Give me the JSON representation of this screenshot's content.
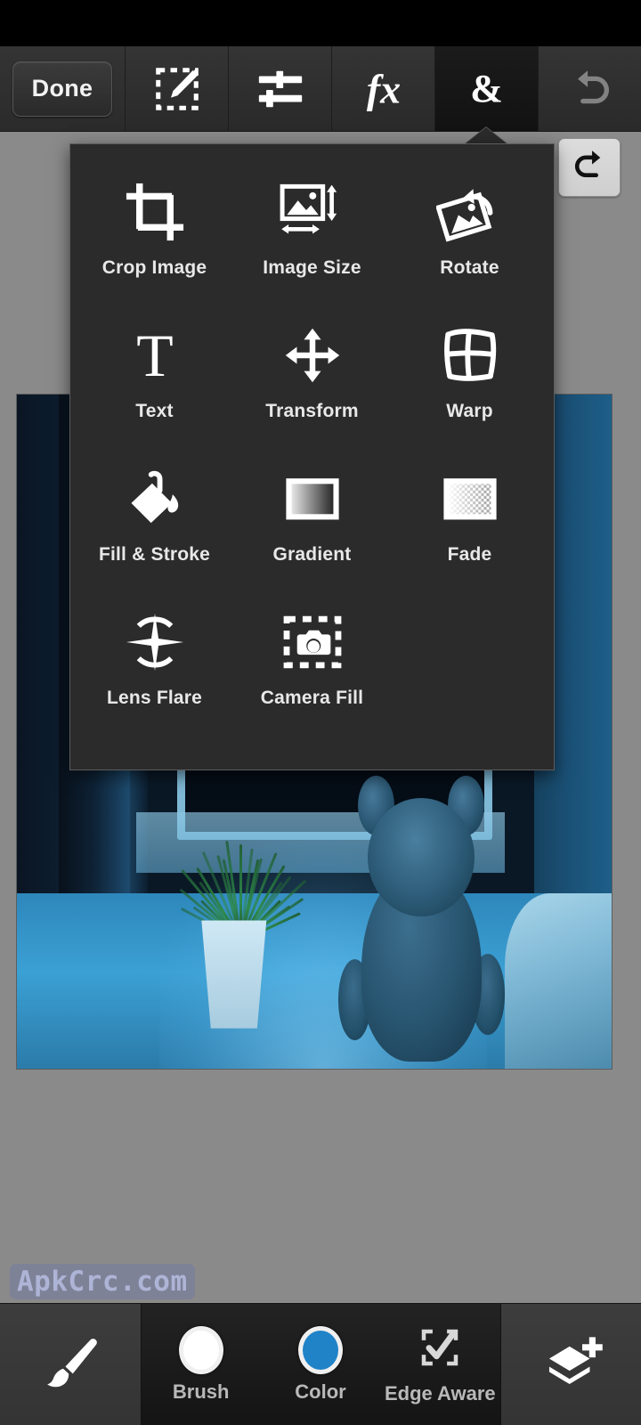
{
  "app": {
    "background_color": "#8a8a8a",
    "accent_color": "#2083c8",
    "panel_color": "#2b2b2b"
  },
  "topbar": {
    "done_label": "Done",
    "tabs": [
      {
        "name": "selection-edit",
        "icon": "selection-pencil-icon",
        "active": false
      },
      {
        "name": "adjustments",
        "icon": "sliders-icon",
        "active": false
      },
      {
        "name": "effects",
        "icon": "fx-icon",
        "active": false
      },
      {
        "name": "add-ons",
        "icon": "ampersand-icon",
        "label": "&",
        "active": true
      },
      {
        "name": "undo",
        "icon": "undo-icon",
        "active": false
      }
    ]
  },
  "redo_button": {
    "label": "",
    "icon": "redo-icon"
  },
  "popup_menu": {
    "items": [
      {
        "label": "Crop Image",
        "icon": "crop-icon"
      },
      {
        "label": "Image Size",
        "icon": "image-size-icon"
      },
      {
        "label": "Rotate",
        "icon": "rotate-icon"
      },
      {
        "label": "Text",
        "icon": "text-icon"
      },
      {
        "label": "Transform",
        "icon": "transform-icon"
      },
      {
        "label": "Warp",
        "icon": "warp-icon"
      },
      {
        "label": "Fill & Stroke",
        "icon": "fill-stroke-icon"
      },
      {
        "label": "Gradient",
        "icon": "gradient-icon"
      },
      {
        "label": "Fade",
        "icon": "fade-icon"
      },
      {
        "label": "Lens Flare",
        "icon": "lens-flare-icon"
      },
      {
        "label": "Camera Fill",
        "icon": "camera-fill-icon"
      }
    ]
  },
  "canvas": {
    "image_description": "Teddy bear and potted plant on a windowsill at night under a starry sky, blue tinted"
  },
  "watermark": {
    "text": "ApkCrc.com"
  },
  "bottombar": {
    "brush_tool": {
      "name": "paintbrush",
      "icon": "paintbrush-icon"
    },
    "items": [
      {
        "label": "Brush",
        "icon": "brush-size-icon",
        "swatch": "#ffffff"
      },
      {
        "label": "Color",
        "icon": "color-swatch-icon",
        "swatch": "#2083c8"
      },
      {
        "label": "Edge Aware",
        "icon": "edge-aware-icon"
      }
    ],
    "add_layer": {
      "name": "add-layer",
      "icon": "add-layer-icon"
    }
  }
}
